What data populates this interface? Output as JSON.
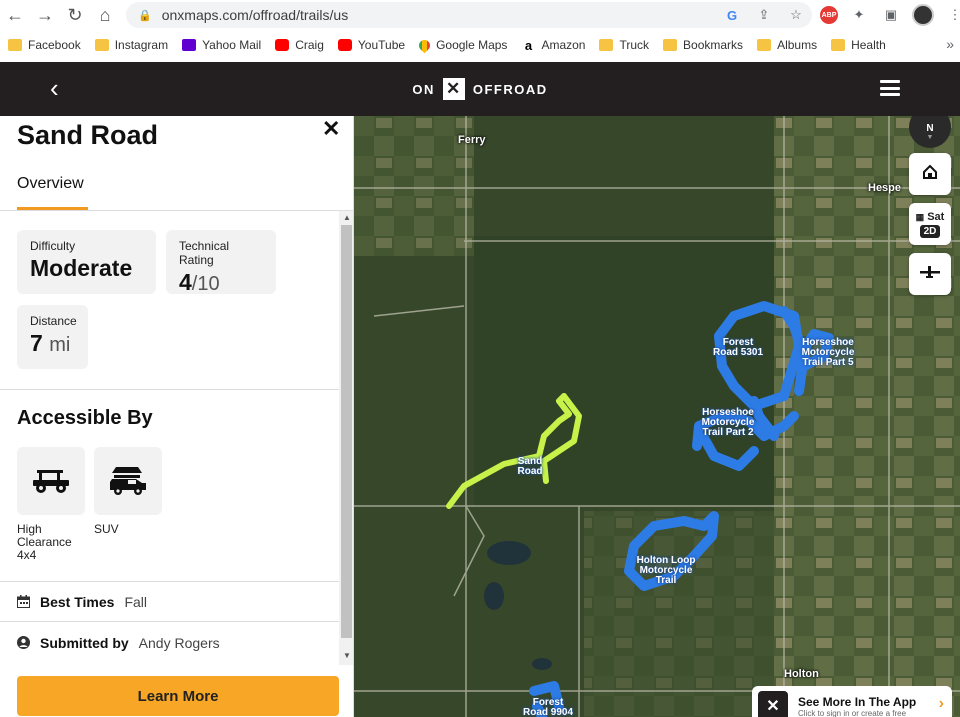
{
  "browser": {
    "url": "onxmaps.com/offroad/trails/us",
    "bookmarks": [
      "Facebook",
      "Instagram",
      "Yahoo Mail",
      "Craig",
      "YouTube",
      "Google Maps",
      "Amazon",
      "Truck",
      "Bookmarks",
      "Albums",
      "Health"
    ]
  },
  "app": {
    "logo_left": "ON",
    "logo_x": "✕",
    "logo_right": "OFFROAD"
  },
  "trail": {
    "name": "Sand Road",
    "tab": "Overview",
    "difficulty_label": "Difficulty",
    "difficulty_value": "Moderate",
    "technical_label": "Technical Rating",
    "technical_value": "4",
    "technical_max": "/10",
    "distance_label": "Distance",
    "distance_value": "7",
    "distance_unit": "mi",
    "accessible_title": "Accessible By",
    "vehicles": [
      {
        "label": "High Clearance 4x4",
        "icon": "utv-icon"
      },
      {
        "label": "SUV",
        "icon": "suv-icon"
      }
    ],
    "best_times_key": "Best Times",
    "best_times_value": "Fall",
    "submitted_key": "Submitted by",
    "submitted_value": "Andy Rogers",
    "learn_more": "Learn More"
  },
  "map": {
    "places": {
      "ferry": "Ferry",
      "hesperia": "Hespe",
      "holton": "Holton"
    },
    "trails": {
      "sand_road": "Sand Road",
      "forest_5301": "Forest Road 5301",
      "horseshoe_5": "Horseshoe Motorcycle Trail Part 5",
      "horseshoe_2": "Horseshoe Motorcycle Trail Part 2",
      "holton_loop": "Holton Loop Motorcycle Trail",
      "forest_9904": "Forest Road 9904"
    },
    "compass": "N",
    "layer": "Sat",
    "mode": "2D",
    "promo_title": "See More In The App",
    "promo_sub": "Click to sign in or create a free"
  },
  "colors": {
    "accent": "#f29a1f",
    "header": "#231f20",
    "trail_highlight": "#c6f24a",
    "trail_blue": "#2d7be5"
  }
}
